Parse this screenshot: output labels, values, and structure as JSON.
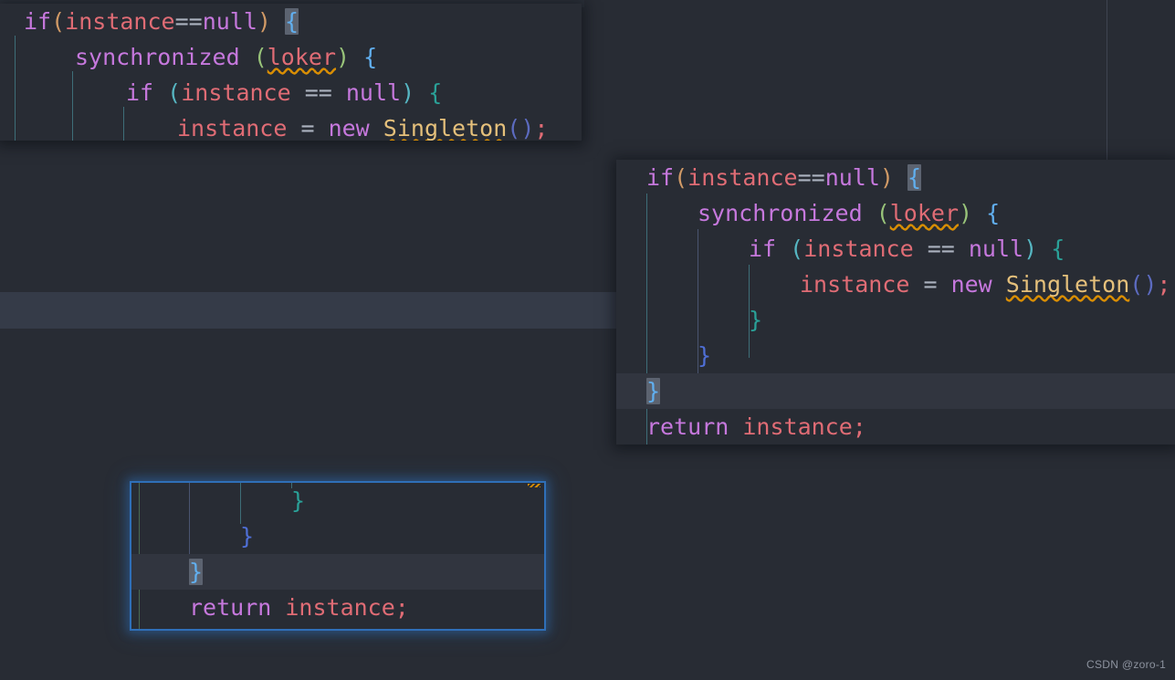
{
  "theme": {
    "editor_bg": "#282c34",
    "page_bg": "#272b35",
    "caret_row_bg": "#353b48",
    "selection_box_border": "#2f6fb8",
    "brace_highlight_bg": "#5c6370",
    "squiggle_color": "#d98e04",
    "margin_guide": "#3f4451"
  },
  "watermark": {
    "text": "CSDN @zoro-1"
  },
  "cards": {
    "top_left": {
      "name": "code-snippet-top-left",
      "lines": [
        {
          "tokens": [
            {
              "t": "if",
              "c": "k-kw"
            },
            {
              "t": "(",
              "c": "k-paren-y"
            },
            {
              "t": "instance",
              "c": "k-var"
            },
            {
              "t": "==",
              "c": "k-op"
            },
            {
              "t": "null",
              "c": "k-null"
            },
            {
              "t": ")",
              "c": "k-paren-y"
            },
            {
              "t": " ",
              "c": "k-op"
            },
            {
              "t": "{",
              "c": "k-brace-b brace-hl"
            }
          ],
          "indent": 0
        },
        {
          "tokens": [
            {
              "t": "synchronized",
              "c": "k-kw"
            },
            {
              "t": " ",
              "c": "k-op"
            },
            {
              "t": "(",
              "c": "k-paren-g"
            },
            {
              "t": "loker",
              "c": "k-var squiggle"
            },
            {
              "t": ")",
              "c": "k-paren-g"
            },
            {
              "t": " ",
              "c": "k-op"
            },
            {
              "t": "{",
              "c": "k-brace-b"
            }
          ],
          "indent": 2
        },
        {
          "tokens": [
            {
              "t": "if",
              "c": "k-kw"
            },
            {
              "t": " ",
              "c": "k-op"
            },
            {
              "t": "(",
              "c": "k-paren-c"
            },
            {
              "t": "instance",
              "c": "k-var"
            },
            {
              "t": " == ",
              "c": "k-op"
            },
            {
              "t": "null",
              "c": "k-null"
            },
            {
              "t": ")",
              "c": "k-paren-c"
            },
            {
              "t": " ",
              "c": "k-op"
            },
            {
              "t": "{",
              "c": "k-brace-g"
            }
          ],
          "indent": 4
        },
        {
          "tokens": [
            {
              "t": "instance",
              "c": "k-var"
            },
            {
              "t": " = ",
              "c": "k-op"
            },
            {
              "t": "new",
              "c": "k-kw"
            },
            {
              "t": " ",
              "c": "k-op"
            },
            {
              "t": "Singleton",
              "c": "k-type squiggle"
            },
            {
              "t": "()",
              "c": "k-paren-b"
            },
            {
              "t": ";",
              "c": "k-semi"
            }
          ],
          "indent": 6
        }
      ]
    },
    "right": {
      "name": "code-snippet-right",
      "lines": [
        {
          "tokens": [
            {
              "t": "if",
              "c": "k-kw"
            },
            {
              "t": "(",
              "c": "k-paren-y"
            },
            {
              "t": "instance",
              "c": "k-var"
            },
            {
              "t": "==",
              "c": "k-op"
            },
            {
              "t": "null",
              "c": "k-null"
            },
            {
              "t": ")",
              "c": "k-paren-y"
            },
            {
              "t": " ",
              "c": "k-op"
            },
            {
              "t": "{",
              "c": "k-brace-b brace-hl"
            }
          ],
          "indent": 0
        },
        {
          "tokens": [
            {
              "t": "synchronized",
              "c": "k-kw"
            },
            {
              "t": " ",
              "c": "k-op"
            },
            {
              "t": "(",
              "c": "k-paren-g"
            },
            {
              "t": "loker",
              "c": "k-var squiggle"
            },
            {
              "t": ")",
              "c": "k-paren-g"
            },
            {
              "t": " ",
              "c": "k-op"
            },
            {
              "t": "{",
              "c": "k-brace-b"
            }
          ],
          "indent": 2
        },
        {
          "tokens": [
            {
              "t": "if",
              "c": "k-kw"
            },
            {
              "t": " ",
              "c": "k-op"
            },
            {
              "t": "(",
              "c": "k-paren-c"
            },
            {
              "t": "instance",
              "c": "k-var"
            },
            {
              "t": " == ",
              "c": "k-op"
            },
            {
              "t": "null",
              "c": "k-null"
            },
            {
              "t": ")",
              "c": "k-paren-c"
            },
            {
              "t": " ",
              "c": "k-op"
            },
            {
              "t": "{",
              "c": "k-brace-g"
            }
          ],
          "indent": 4
        },
        {
          "tokens": [
            {
              "t": "instance",
              "c": "k-var"
            },
            {
              "t": " = ",
              "c": "k-op"
            },
            {
              "t": "new",
              "c": "k-kw"
            },
            {
              "t": " ",
              "c": "k-op"
            },
            {
              "t": "Singleton",
              "c": "k-type squiggle"
            },
            {
              "t": "()",
              "c": "k-paren-b"
            },
            {
              "t": ";",
              "c": "k-semi"
            }
          ],
          "indent": 6
        },
        {
          "tokens": [
            {
              "t": "}",
              "c": "k-brace-g"
            }
          ],
          "indent": 4
        },
        {
          "tokens": [
            {
              "t": "}",
              "c": "k-brace-i"
            }
          ],
          "indent": 2
        },
        {
          "tokens": [
            {
              "t": "}",
              "c": "k-brace-b brace-hl"
            }
          ],
          "indent": 0,
          "row_highlight": true
        },
        {
          "tokens": [
            {
              "t": "return",
              "c": "k-kw"
            },
            {
              "t": " ",
              "c": "k-op"
            },
            {
              "t": "instance",
              "c": "k-var"
            },
            {
              "t": ";",
              "c": "k-semi"
            }
          ],
          "indent": 0
        }
      ]
    },
    "bottom_left": {
      "name": "code-snippet-bottom-left",
      "lines": [
        {
          "tokens": [
            {
              "t": "}",
              "c": "k-brace-g"
            }
          ],
          "indent": 4
        },
        {
          "tokens": [
            {
              "t": "}",
              "c": "k-brace-i"
            }
          ],
          "indent": 2
        },
        {
          "tokens": [
            {
              "t": "}",
              "c": "k-brace-b brace-hl"
            }
          ],
          "indent": 0,
          "row_highlight": true
        },
        {
          "tokens": [
            {
              "t": "return",
              "c": "k-kw"
            },
            {
              "t": " ",
              "c": "k-op"
            },
            {
              "t": "instance",
              "c": "k-var"
            },
            {
              "t": ";",
              "c": "k-semi"
            }
          ],
          "indent": 0
        }
      ]
    },
    "top_strip": {
      "name": "code-snippet-top-strip",
      "lines": [
        {
          "tokens": [
            {
              "t": "|",
              "c": "k-brace-i"
            },
            {
              "t": "|",
              "c": "k-paren-c"
            },
            {
              "t": "|",
              "c": "k-var"
            },
            {
              "t": "{",
              "c": "k-brace-g"
            }
          ],
          "indent": 0
        }
      ]
    }
  }
}
